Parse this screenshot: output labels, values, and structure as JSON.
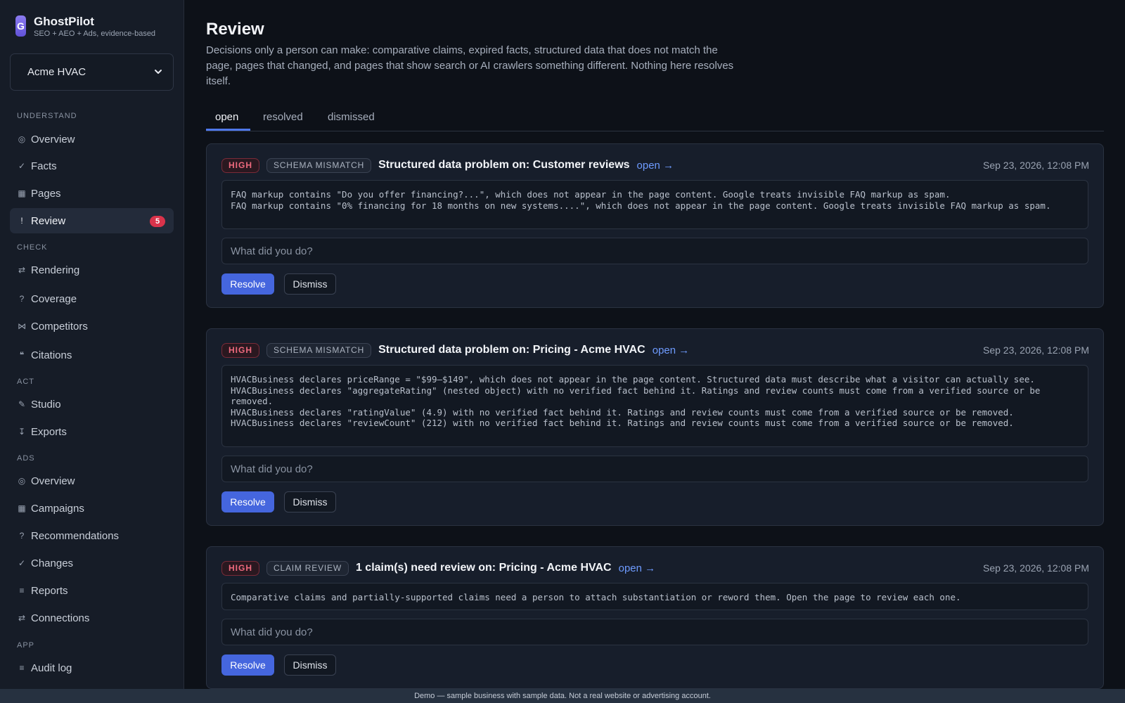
{
  "brand": {
    "logo_letter": "G",
    "name": "GhostPilot",
    "tagline": "SEO + AEO + Ads, evidence-based"
  },
  "site_selector": {
    "value": "Acme HVAC"
  },
  "sidebar": {
    "sections": [
      {
        "label": "UNDERSTAND"
      },
      {
        "label": "CHECK"
      },
      {
        "label": "ACT"
      },
      {
        "label": "ADS"
      },
      {
        "label": "APP"
      }
    ],
    "items": [
      {
        "icon": "◎",
        "label": "Overview"
      },
      {
        "icon": "✓",
        "label": "Facts"
      },
      {
        "icon": "▦",
        "label": "Pages"
      },
      {
        "icon": "!",
        "label": "Review",
        "badge": "5"
      },
      {
        "icon": "⇄",
        "label": "Rendering"
      },
      {
        "icon": "?",
        "label": "Coverage"
      },
      {
        "icon": "⋈",
        "label": "Competitors"
      },
      {
        "icon": "❝",
        "label": "Citations"
      },
      {
        "icon": "✎",
        "label": "Studio"
      },
      {
        "icon": "↧",
        "label": "Exports"
      },
      {
        "icon": "◎",
        "label": "Overview"
      },
      {
        "icon": "▦",
        "label": "Campaigns"
      },
      {
        "icon": "?",
        "label": "Recommendations"
      },
      {
        "icon": "✓",
        "label": "Changes"
      },
      {
        "icon": "≡",
        "label": "Reports"
      },
      {
        "icon": "⇄",
        "label": "Connections"
      },
      {
        "icon": "≡",
        "label": "Audit log"
      }
    ]
  },
  "page": {
    "title": "Review",
    "description": "Decisions only a person can make: comparative claims, expired facts, structured data that does not match the page, pages that changed, and pages that show search or AI crawlers something different. Nothing here resolves itself."
  },
  "tabs": [
    {
      "label": "open"
    },
    {
      "label": "resolved"
    },
    {
      "label": "dismissed"
    }
  ],
  "cards": [
    {
      "severity": "HIGH",
      "kind": "SCHEMA MISMATCH",
      "title": "Structured data problem on: Customer reviews",
      "link": "open →",
      "time": "Sep 23, 2026, 12:08 PM",
      "evidence": "FAQ markup contains \"Do you offer financing?...\", which does not appear in the page content. Google treats invisible FAQ markup as spam.\nFAQ markup contains \"0% financing for 18 months on new systems....\", which does not appear in the page content. Google treats invisible FAQ markup as spam.",
      "note_placeholder": "What did you do?",
      "resolve": "Resolve",
      "dismiss": "Dismiss"
    },
    {
      "severity": "HIGH",
      "kind": "SCHEMA MISMATCH",
      "title": "Structured data problem on: Pricing - Acme HVAC",
      "link": "open →",
      "time": "Sep 23, 2026, 12:08 PM",
      "evidence": "HVACBusiness declares priceRange = \"$99–$149\", which does not appear in the page content. Structured data must describe what a visitor can actually see.\nHVACBusiness declares \"aggregateRating\" (nested object) with no verified fact behind it. Ratings and review counts must come from a verified source or be removed.\nHVACBusiness declares \"ratingValue\" (4.9) with no verified fact behind it. Ratings and review counts must come from a verified source or be removed.\nHVACBusiness declares \"reviewCount\" (212) with no verified fact behind it. Ratings and review counts must come from a verified source or be removed.",
      "note_placeholder": "What did you do?",
      "resolve": "Resolve",
      "dismiss": "Dismiss"
    },
    {
      "severity": "HIGH",
      "kind": "CLAIM REVIEW",
      "title": "1 claim(s) need review on: Pricing - Acme HVAC",
      "link": "open →",
      "time": "Sep 23, 2026, 12:08 PM",
      "evidence": "Comparative claims and partially-supported claims need a person to attach substantiation or reword them. Open the page to review each one.",
      "note_placeholder": "What did you do?",
      "resolve": "Resolve",
      "dismiss": "Dismiss"
    }
  ],
  "footer": {
    "text": "Demo — sample business with sample data. Not a real website or advertising account."
  },
  "colors": {
    "accent": "#4566de",
    "link": "#6e9bff",
    "high": "#ef6a7e",
    "badge": "#d9334b"
  }
}
